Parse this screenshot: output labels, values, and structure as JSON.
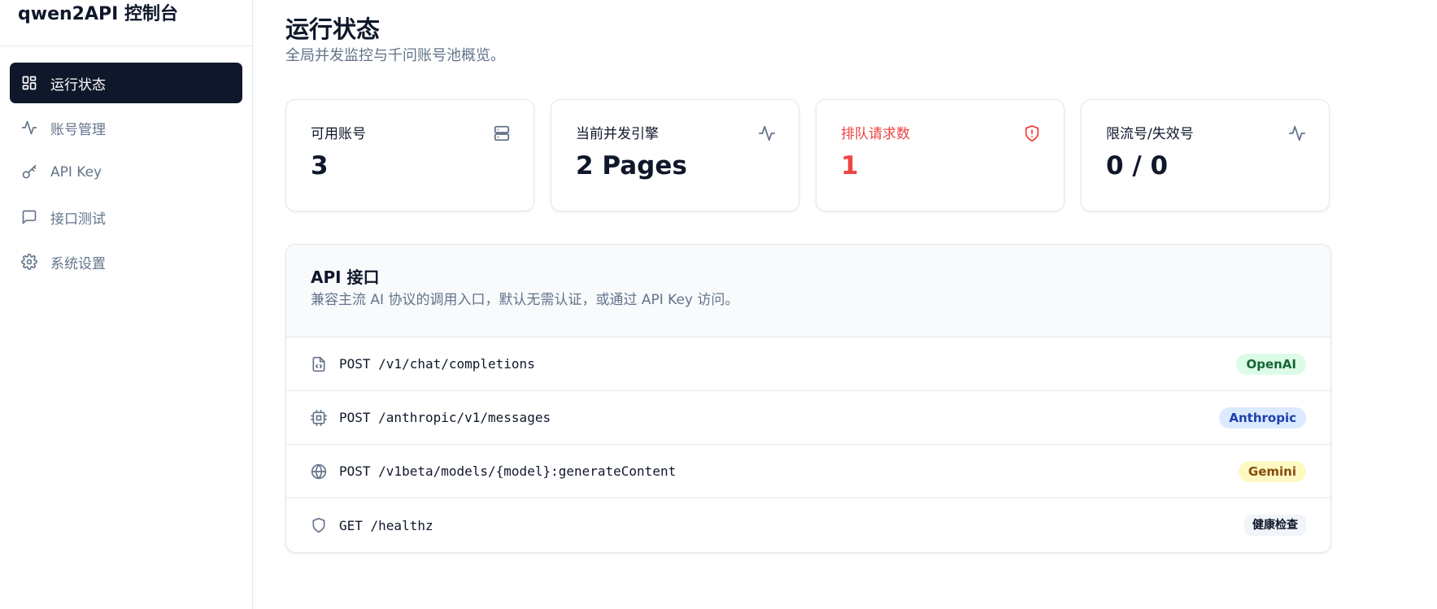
{
  "app": {
    "title": "qwen2API 控制台"
  },
  "sidebar": {
    "items": [
      {
        "label": "运行状态",
        "icon": "dashboard-icon",
        "active": true
      },
      {
        "label": "账号管理",
        "icon": "activity-icon",
        "active": false
      },
      {
        "label": "API Key",
        "icon": "key-icon",
        "active": false
      },
      {
        "label": "接口测试",
        "icon": "message-square-icon",
        "active": false
      },
      {
        "label": "系统设置",
        "icon": "gear-icon",
        "active": false
      }
    ]
  },
  "page": {
    "title": "运行状态",
    "subtitle": "全局并发监控与千问账号池概览。"
  },
  "stats": [
    {
      "label": "可用账号",
      "value": "3",
      "icon": "server-icon"
    },
    {
      "label": "当前并发引擎",
      "value": "2 Pages",
      "icon": "activity-icon"
    },
    {
      "label": "排队请求数",
      "value": "1",
      "icon": "alert-shield-icon",
      "color": "#ef4444"
    },
    {
      "label": "限流号/失效号",
      "value": "0 / 0",
      "icon": "activity-icon"
    }
  ],
  "api": {
    "title": "API 接口",
    "description": "兼容主流 AI 协议的调用入口，默认无需认证，或通过 API Key 访问。",
    "endpoints": [
      {
        "endpoint": "POST /v1/chat/completions",
        "badge": "OpenAI",
        "icon": "file-code-icon"
      },
      {
        "endpoint": "POST /anthropic/v1/messages",
        "badge": "Anthropic",
        "icon": "cpu-icon"
      },
      {
        "endpoint": "POST /v1beta/models/{model}:generateContent",
        "badge": "Gemini",
        "icon": "globe-icon"
      },
      {
        "endpoint": "GET /healthz",
        "badge": "健康检查",
        "icon": "shield-icon"
      }
    ]
  }
}
